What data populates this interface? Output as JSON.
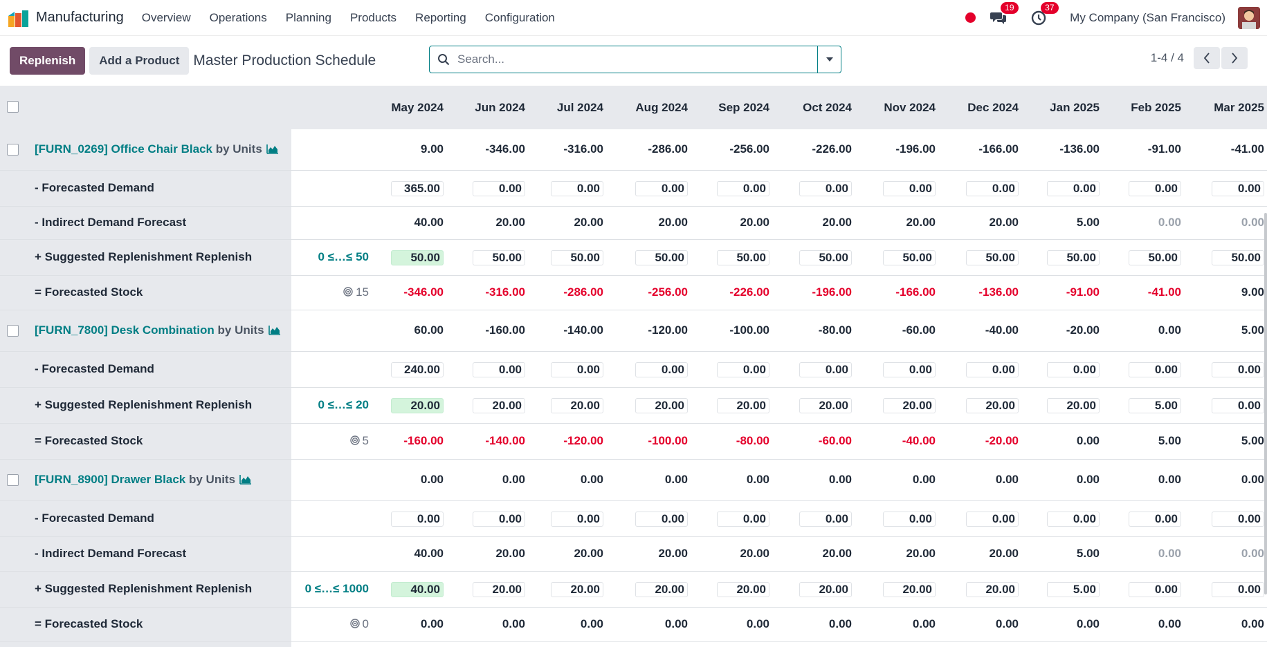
{
  "navbar": {
    "app_name": "Manufacturing",
    "menu": [
      "Overview",
      "Operations",
      "Planning",
      "Products",
      "Reporting",
      "Configuration"
    ],
    "messages_count": "19",
    "activities_count": "37",
    "company": "My Company (San Francisco)",
    "status_color": "#e4002b"
  },
  "control": {
    "replenish_label": "Replenish",
    "add_product_label": "Add a Product",
    "breadcrumb": "Master Production Schedule",
    "search_placeholder": "Search...",
    "pager": "1-4 / 4"
  },
  "colors": {
    "accent": "#714b67",
    "link": "#017e84",
    "negative": "#e4002b",
    "suggested": "#d4f4dc"
  },
  "months": [
    "May 2024",
    "Jun 2024",
    "Jul 2024",
    "Aug 2024",
    "Sep 2024",
    "Oct 2024",
    "Nov 2024",
    "Dec 2024",
    "Jan 2025",
    "Feb 2025",
    "Mar 2025"
  ],
  "products": [
    {
      "name": "[FURN_0269] Office Chair Black",
      "unit": "by Units",
      "starting": [
        "9.00",
        "-346.00",
        "-316.00",
        "-286.00",
        "-256.00",
        "-226.00",
        "-196.00",
        "-166.00",
        "-136.00",
        "-91.00",
        "-41.00"
      ],
      "forecasted_demand_label": "- Forecasted Demand",
      "forecasted_demand": [
        "365.00",
        "0.00",
        "0.00",
        "0.00",
        "0.00",
        "0.00",
        "0.00",
        "0.00",
        "0.00",
        "0.00",
        "0.00"
      ],
      "indirect_label": "- Indirect Demand Forecast",
      "indirect": [
        "40.00",
        "20.00",
        "20.00",
        "20.00",
        "20.00",
        "20.00",
        "20.00",
        "20.00",
        "5.00",
        "0.00",
        "0.00"
      ],
      "suggested_label": "+ Suggested Replenishment",
      "replenish_link": "Replenish",
      "range": "0 ≤…≤ 50",
      "suggested": [
        "50.00",
        "50.00",
        "50.00",
        "50.00",
        "50.00",
        "50.00",
        "50.00",
        "50.00",
        "50.00",
        "50.00",
        "50.00"
      ],
      "stock_label": "= Forecasted Stock",
      "safety": "15",
      "stock": [
        "-346.00",
        "-316.00",
        "-286.00",
        "-256.00",
        "-226.00",
        "-196.00",
        "-166.00",
        "-136.00",
        "-91.00",
        "-41.00",
        "9.00"
      ]
    },
    {
      "name": "[FURN_7800] Desk Combination",
      "unit": "by Units",
      "starting": [
        "60.00",
        "-160.00",
        "-140.00",
        "-120.00",
        "-100.00",
        "-80.00",
        "-60.00",
        "-40.00",
        "-20.00",
        "0.00",
        "5.00"
      ],
      "forecasted_demand_label": "- Forecasted Demand",
      "forecasted_demand": [
        "240.00",
        "0.00",
        "0.00",
        "0.00",
        "0.00",
        "0.00",
        "0.00",
        "0.00",
        "0.00",
        "0.00",
        "0.00"
      ],
      "suggested_label": "+ Suggested Replenishment",
      "replenish_link": "Replenish",
      "range": "0 ≤…≤ 20",
      "suggested": [
        "20.00",
        "20.00",
        "20.00",
        "20.00",
        "20.00",
        "20.00",
        "20.00",
        "20.00",
        "20.00",
        "5.00",
        "0.00"
      ],
      "stock_label": "= Forecasted Stock",
      "safety": "5",
      "stock": [
        "-160.00",
        "-140.00",
        "-120.00",
        "-100.00",
        "-80.00",
        "-60.00",
        "-40.00",
        "-20.00",
        "0.00",
        "5.00",
        "5.00"
      ]
    },
    {
      "name": "[FURN_8900] Drawer Black",
      "unit": "by Units",
      "starting": [
        "0.00",
        "0.00",
        "0.00",
        "0.00",
        "0.00",
        "0.00",
        "0.00",
        "0.00",
        "0.00",
        "0.00",
        "0.00"
      ],
      "forecasted_demand_label": "- Forecasted Demand",
      "forecasted_demand": [
        "0.00",
        "0.00",
        "0.00",
        "0.00",
        "0.00",
        "0.00",
        "0.00",
        "0.00",
        "0.00",
        "0.00",
        "0.00"
      ],
      "indirect_label": "- Indirect Demand Forecast",
      "indirect": [
        "40.00",
        "20.00",
        "20.00",
        "20.00",
        "20.00",
        "20.00",
        "20.00",
        "20.00",
        "5.00",
        "0.00",
        "0.00"
      ],
      "suggested_label": "+ Suggested Replenishment",
      "replenish_link": "Replenish",
      "range": "0 ≤…≤ 1000",
      "suggested": [
        "40.00",
        "20.00",
        "20.00",
        "20.00",
        "20.00",
        "20.00",
        "20.00",
        "20.00",
        "5.00",
        "0.00",
        "0.00"
      ],
      "stock_label": "= Forecasted Stock",
      "safety": "0",
      "stock": [
        "0.00",
        "0.00",
        "0.00",
        "0.00",
        "0.00",
        "0.00",
        "0.00",
        "0.00",
        "0.00",
        "0.00",
        "0.00"
      ]
    }
  ]
}
